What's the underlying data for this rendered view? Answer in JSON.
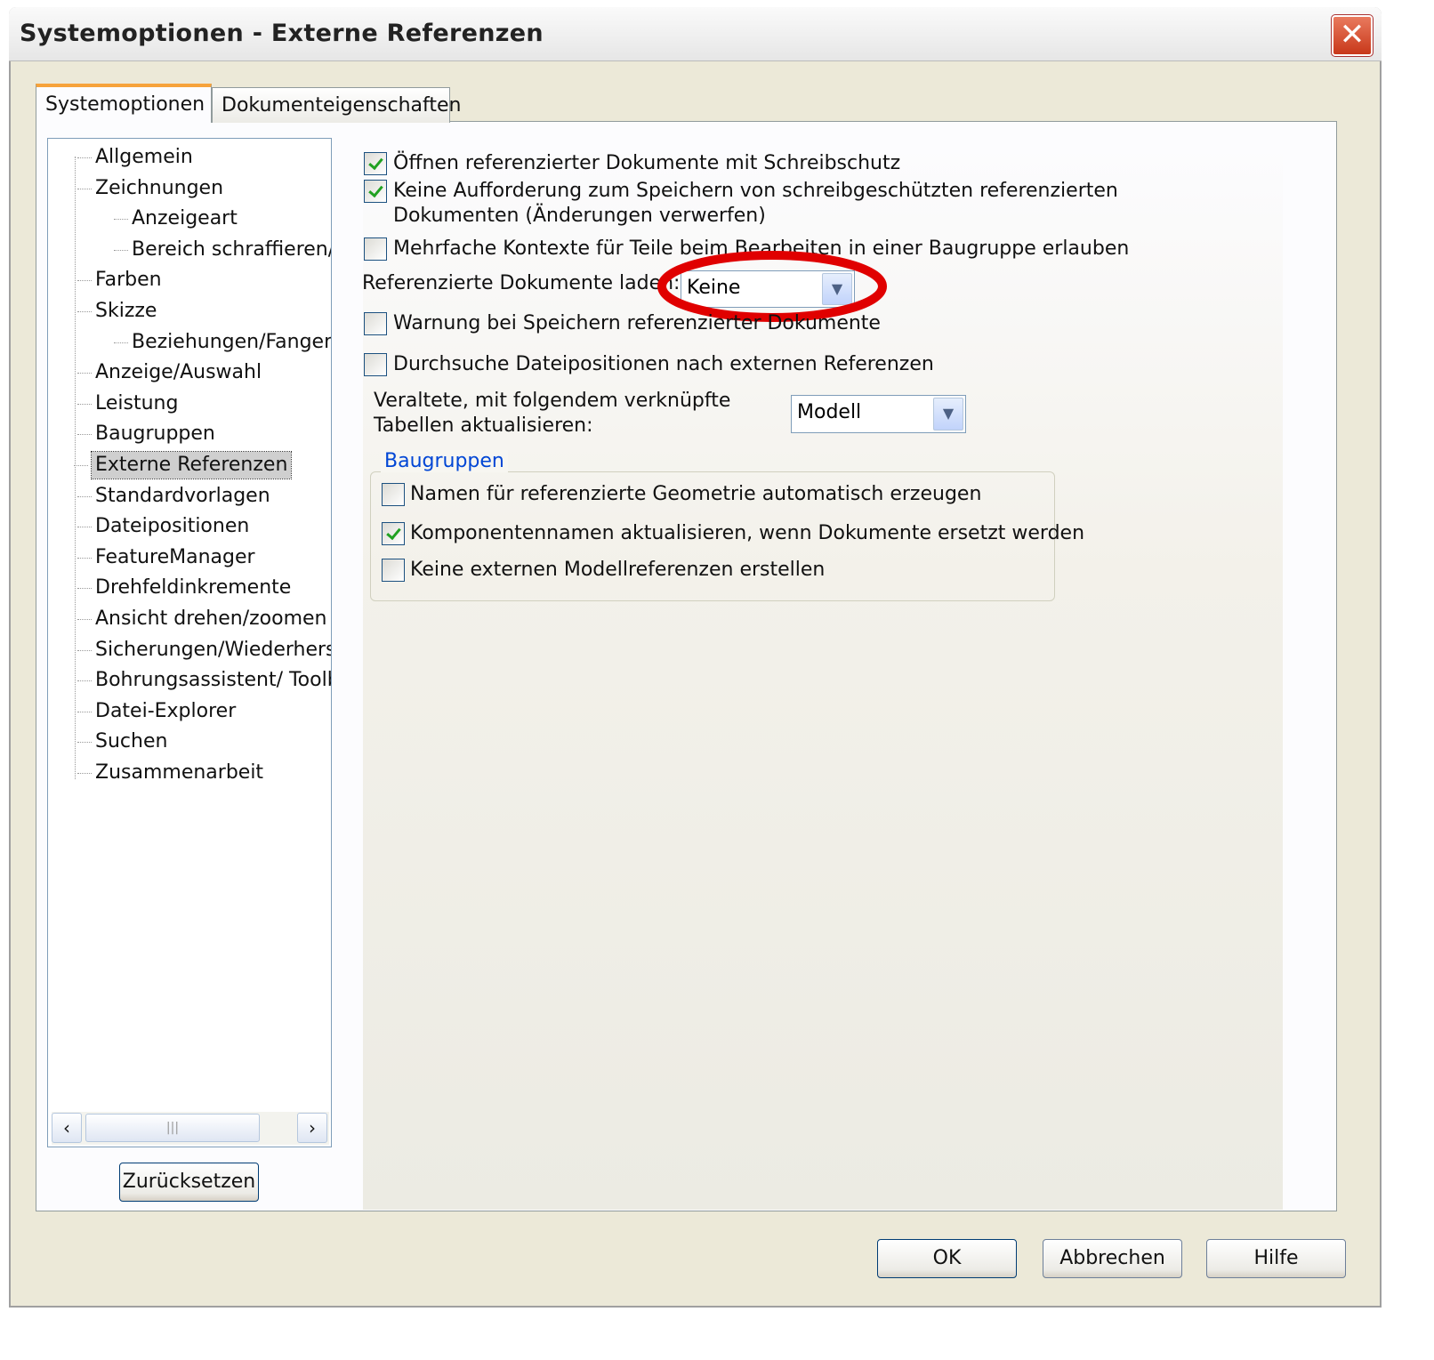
{
  "window": {
    "title": "Systemoptionen - Externe Referenzen",
    "close_icon": "close-icon"
  },
  "tabs": [
    {
      "label": "Systemoptionen",
      "active": true
    },
    {
      "label": "Dokumenteigenschaften",
      "active": false
    }
  ],
  "tree": {
    "items": [
      {
        "label": "Allgemein",
        "level": 0
      },
      {
        "label": "Zeichnungen",
        "level": 0
      },
      {
        "label": "Anzeigeart",
        "level": 1
      },
      {
        "label": "Bereich schraffieren/f",
        "level": 1
      },
      {
        "label": "Farben",
        "level": 0
      },
      {
        "label": "Skizze",
        "level": 0
      },
      {
        "label": "Beziehungen/Fangen",
        "level": 1
      },
      {
        "label": "Anzeige/Auswahl",
        "level": 0
      },
      {
        "label": "Leistung",
        "level": 0
      },
      {
        "label": "Baugruppen",
        "level": 0
      },
      {
        "label": "Externe Referenzen",
        "level": 0,
        "selected": true
      },
      {
        "label": "Standardvorlagen",
        "level": 0
      },
      {
        "label": "Dateipositionen",
        "level": 0
      },
      {
        "label": "FeatureManager",
        "level": 0
      },
      {
        "label": "Drehfeldinkremente",
        "level": 0
      },
      {
        "label": "Ansicht drehen/zoomen",
        "level": 0
      },
      {
        "label": "Sicherungen/Wiederherst",
        "level": 0
      },
      {
        "label": "Bohrungsassistent/ Toolb",
        "level": 0
      },
      {
        "label": "Datei-Explorer",
        "level": 0
      },
      {
        "label": "Suchen",
        "level": 0
      },
      {
        "label": "Zusammenarbeit",
        "level": 0
      }
    ],
    "scroll_thumb": "|||"
  },
  "reset_label": "Zurücksetzen",
  "options": {
    "open_readonly": {
      "label": "Öffnen referenzierter Dokumente mit Schreibschutz",
      "checked": true
    },
    "no_prompt": {
      "label": "Keine Aufforderung zum Speichern von schreibgeschützten referenzierten",
      "label2": "Dokumenten (Änderungen verwerfen)",
      "checked": true
    },
    "multi_context": {
      "label": "Mehrfache Kontexte für Teile beim Bearbeiten in einer Baugruppe erlauben",
      "checked": false
    },
    "load_label": "Referenzierte Dokumente laden:",
    "load_value": "Keine",
    "warn_save": {
      "label": "Warnung bei Speichern referenzierter Dokumente",
      "checked": false
    },
    "search_paths": {
      "label": "Durchsuche Dateipositionen nach externen Referenzen",
      "checked": false
    },
    "update_label1": "Veraltete, mit folgendem verknüpfte",
    "update_label2": "Tabellen aktualisieren:",
    "update_value": "Modell"
  },
  "group": {
    "title": "Baugruppen",
    "items": [
      {
        "label": "Namen für referenzierte Geometrie automatisch erzeugen",
        "checked": false
      },
      {
        "label": "Komponentennamen aktualisieren, wenn Dokumente ersetzt werden",
        "checked": true
      },
      {
        "label": "Keine externen Modellreferenzen erstellen",
        "checked": false
      }
    ]
  },
  "buttons": {
    "ok": "OK",
    "cancel": "Abbrechen",
    "help": "Hilfe"
  },
  "highlight_color": "#e00000"
}
